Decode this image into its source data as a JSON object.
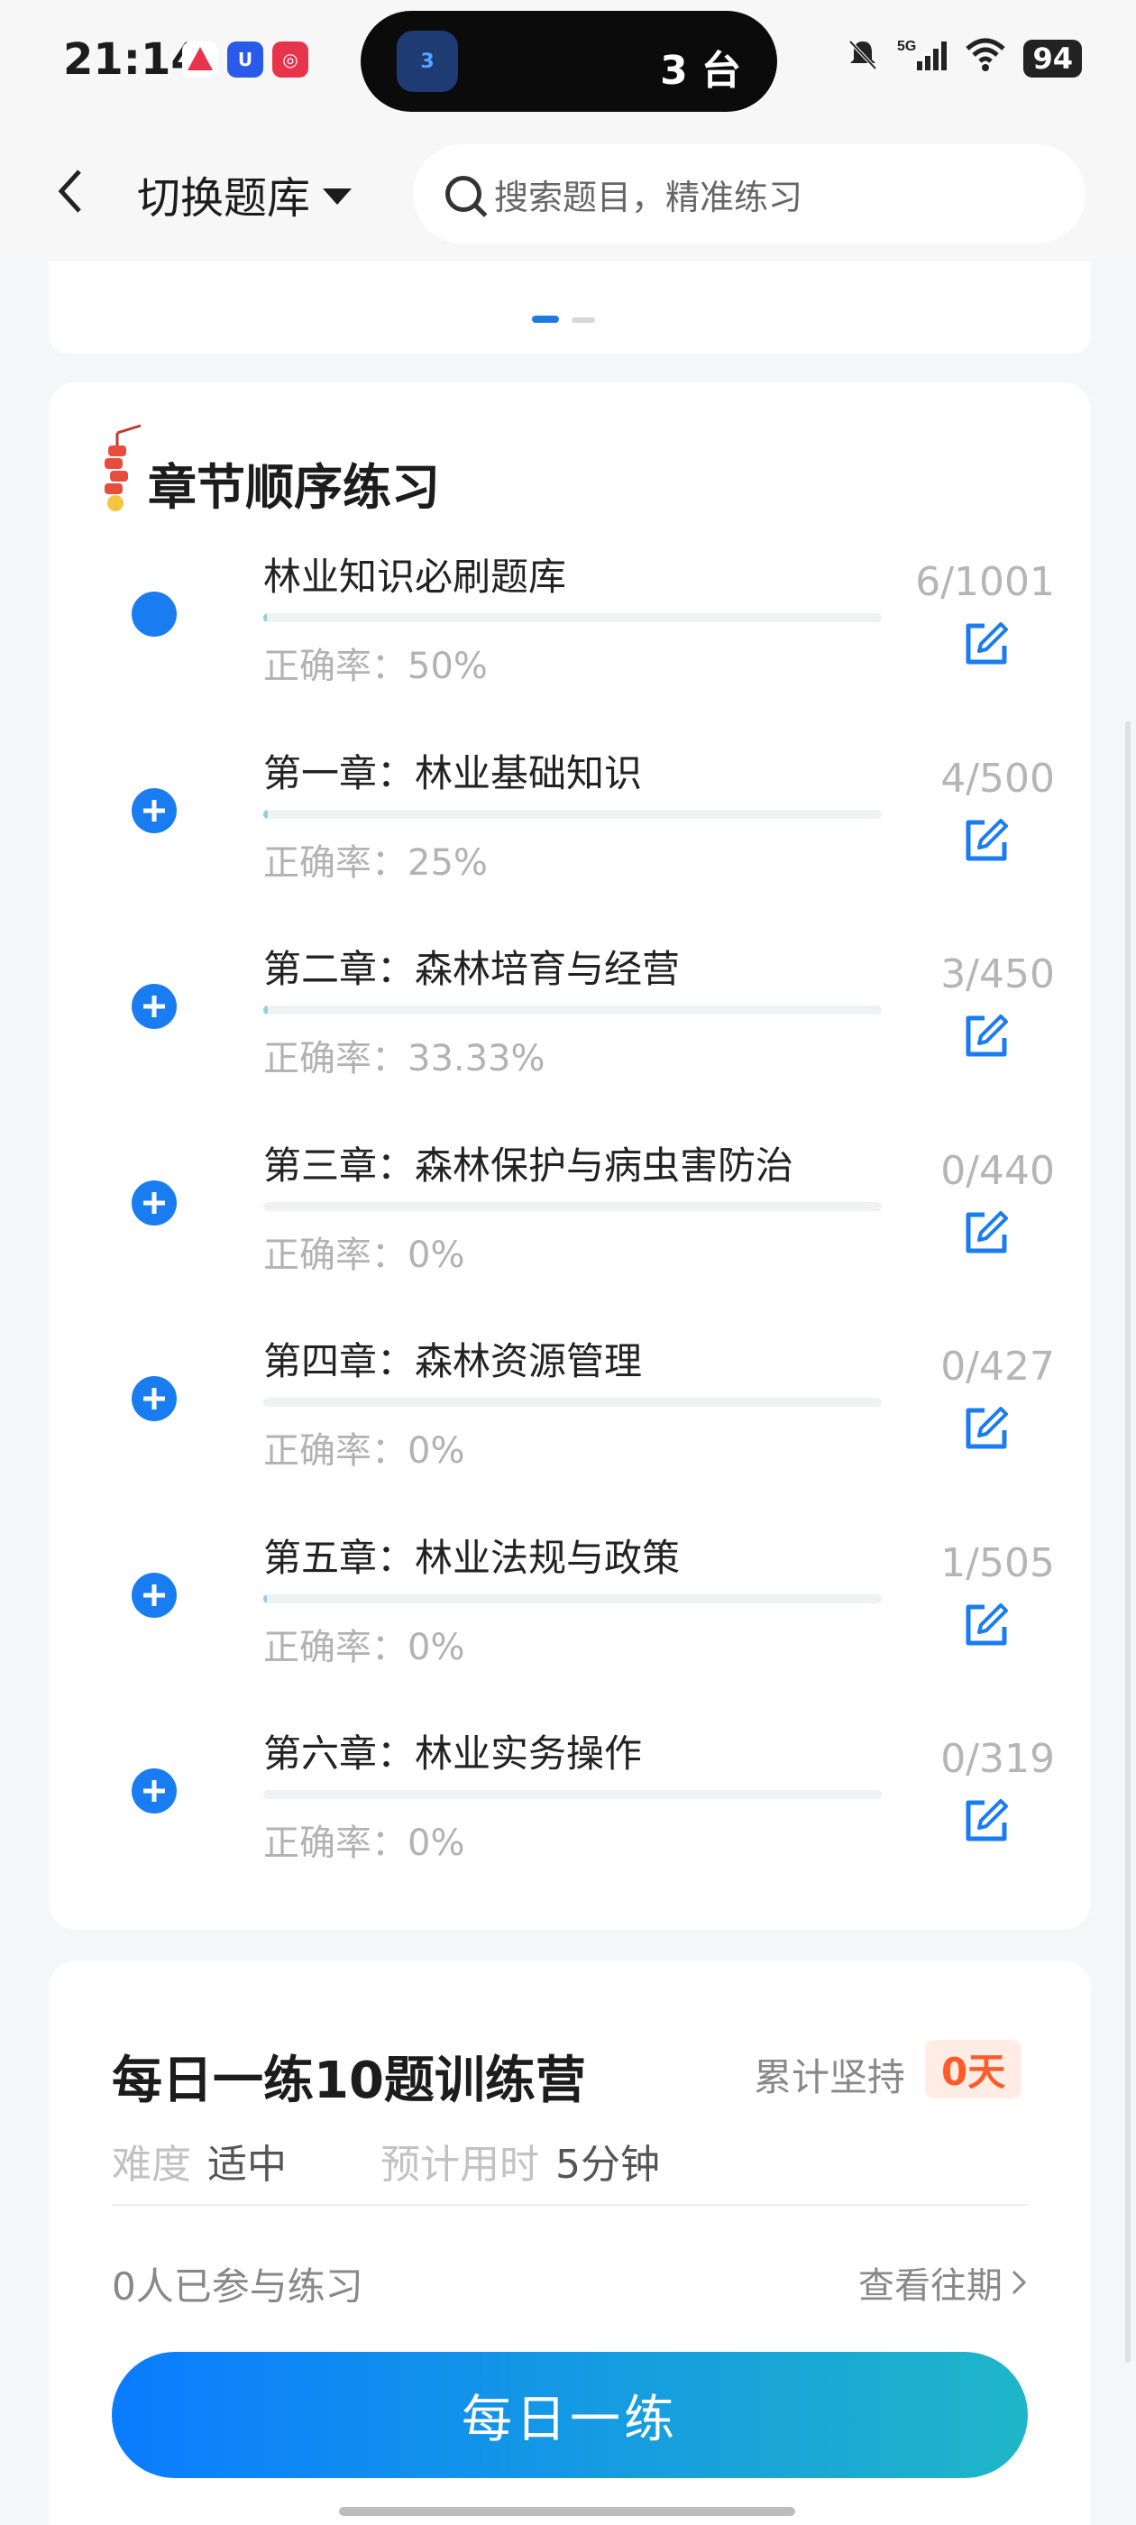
{
  "status_bar": {
    "time": "21:14",
    "island_badge": "3",
    "island_text": "3 台",
    "battery": "94"
  },
  "header": {
    "switch_label": "切换题库",
    "search_placeholder": "搜索题目，精准练习"
  },
  "chapter_section": {
    "title": "章节顺序练习",
    "rows": [
      {
        "name": "林业知识必刷题库",
        "accuracy": "正确率：50%",
        "count": "6/1001",
        "progress": 0.006
      },
      {
        "name": "第一章：林业基础知识",
        "accuracy": "正确率：25%",
        "count": "4/500",
        "progress": 0.008
      },
      {
        "name": "第二章：森林培育与经营",
        "accuracy": "正确率：33.33%",
        "count": "3/450",
        "progress": 0.007
      },
      {
        "name": "第三章：森林保护与病虫害防治",
        "accuracy": "正确率：0%",
        "count": "0/440",
        "progress": 0
      },
      {
        "name": "第四章：森林资源管理",
        "accuracy": "正确率：0%",
        "count": "0/427",
        "progress": 0
      },
      {
        "name": "第五章：林业法规与政策",
        "accuracy": "正确率：0%",
        "count": "1/505",
        "progress": 0.002
      },
      {
        "name": "第六章：林业实务操作",
        "accuracy": "正确率：0%",
        "count": "0/319",
        "progress": 0
      }
    ]
  },
  "daily": {
    "title": "每日一练10题训练营",
    "streak_label": "累计坚持",
    "streak_value": "0天",
    "difficulty_label": "难度",
    "difficulty_value": "适中",
    "time_label": "预计用时",
    "time_value": "5分钟",
    "participants": "0人已参与练习",
    "history_link": "查看往期",
    "button": "每日一练"
  },
  "colors": {
    "accent": "#1a7cf1",
    "gradient_start": "#0a7cff",
    "gradient_end": "#1fb6c8",
    "streak": "#ff5a2a"
  }
}
